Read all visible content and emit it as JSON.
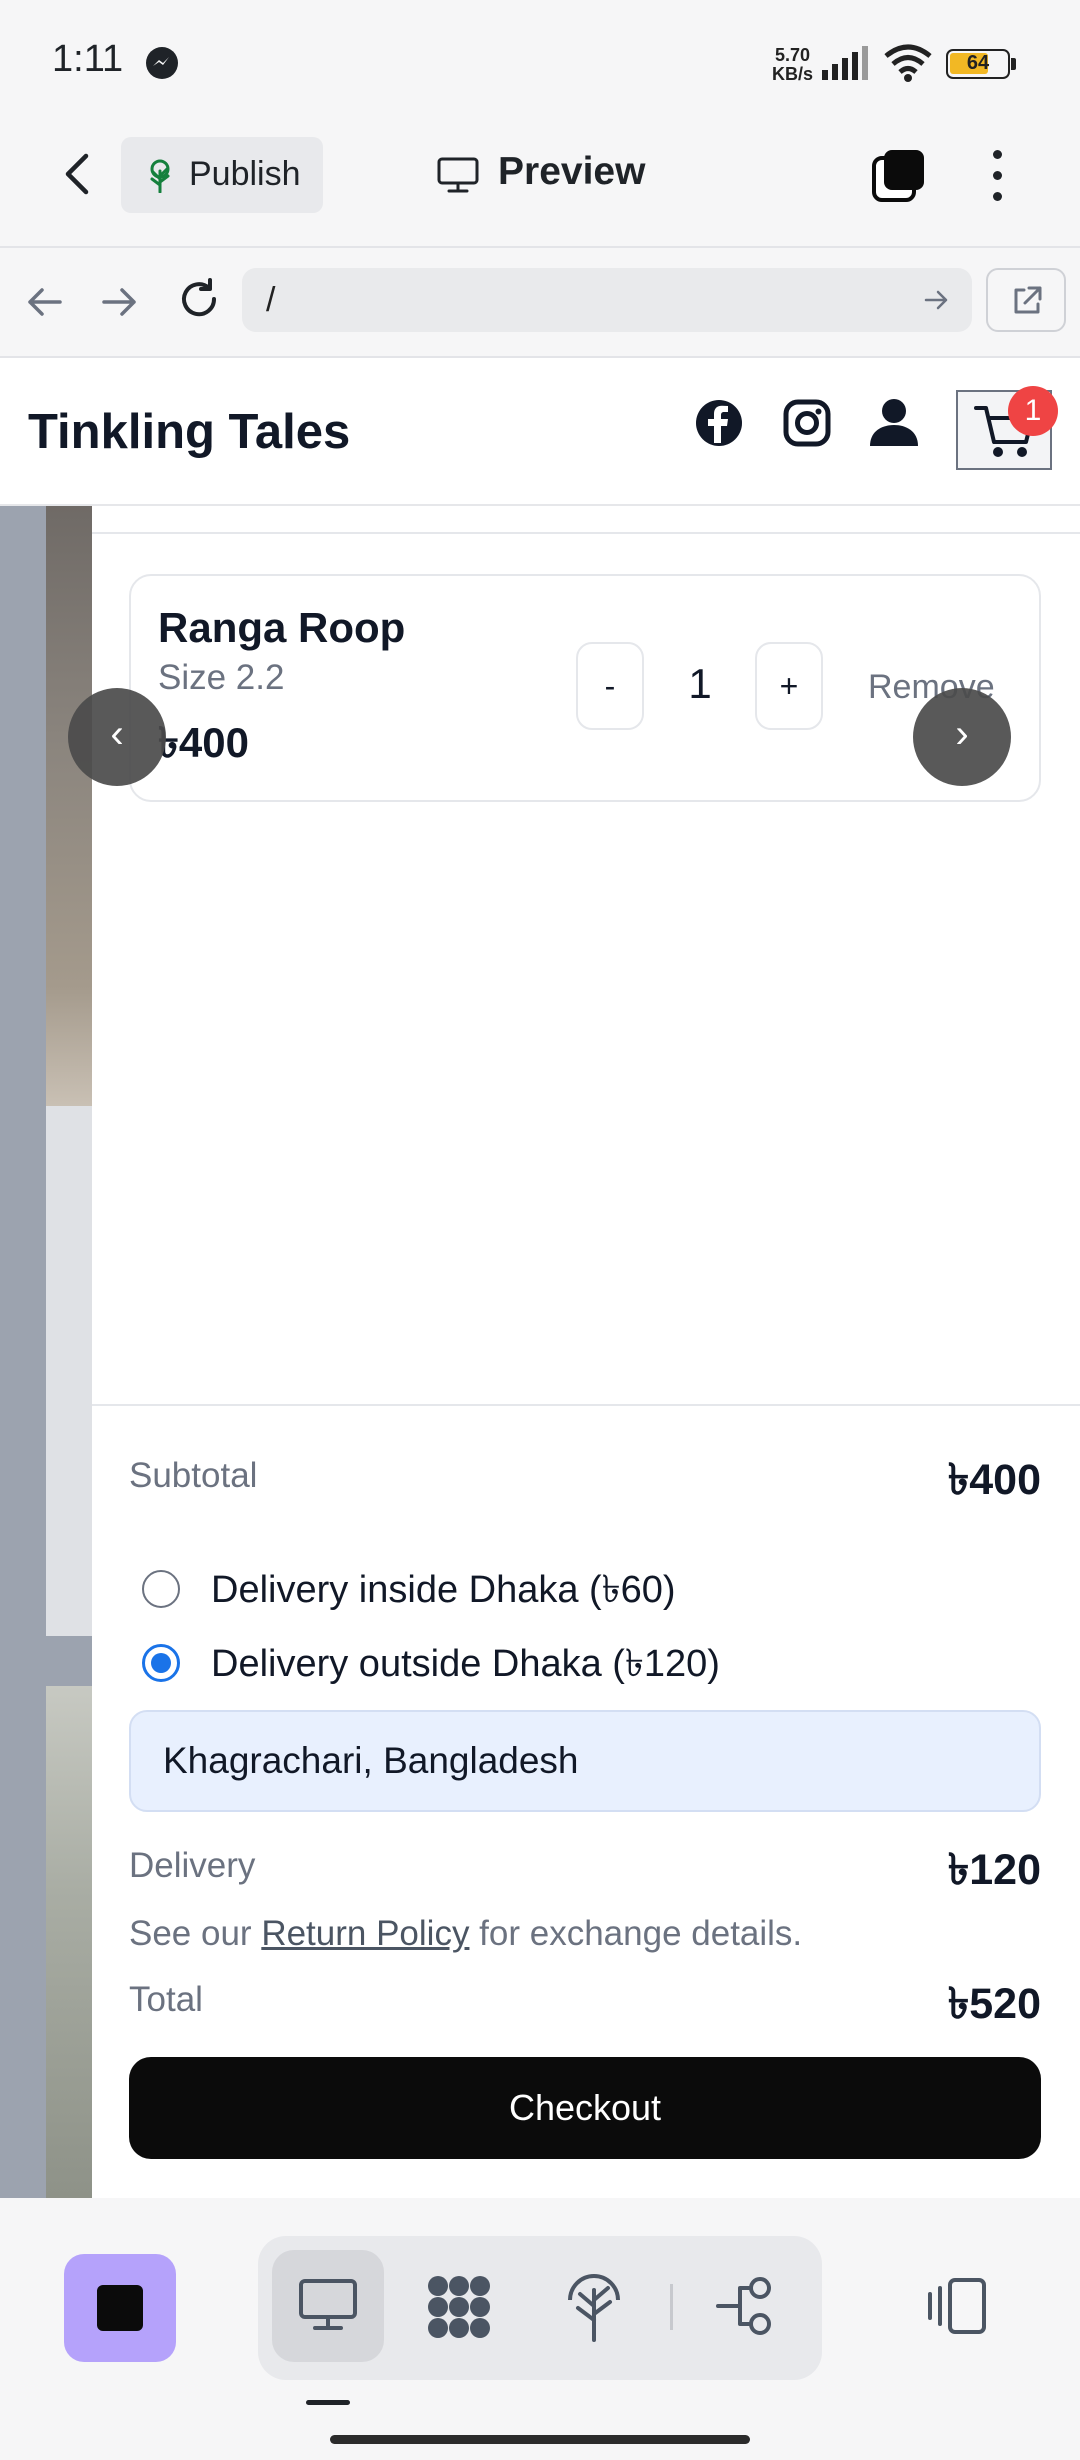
{
  "status_bar": {
    "time": "1:11",
    "net_speed_value": "5.70",
    "net_speed_unit": "KB/s",
    "battery": "64"
  },
  "app_bar": {
    "publish_label": "Publish",
    "preview_label": "Preview"
  },
  "browser": {
    "url": "/"
  },
  "site": {
    "brand": "Tinkling Tales",
    "cart_count": "1"
  },
  "cart": {
    "item": {
      "name": "Ranga Roop",
      "size": "Size 2.2",
      "price": "৳400",
      "quantity": "1",
      "minus_label": "-",
      "plus_label": "+",
      "remove_label": "Remove"
    },
    "carousel": {
      "prev": "‹",
      "next": "›"
    },
    "summary": {
      "subtotal_label": "Subtotal",
      "subtotal_value": "৳400",
      "delivery_options": [
        {
          "label": "Delivery inside Dhaka (৳60)",
          "selected": false
        },
        {
          "label": "Delivery outside Dhaka (৳120)",
          "selected": true
        }
      ],
      "address_value": "Khagrachari, Bangladesh",
      "delivery_label": "Delivery",
      "delivery_value": "৳120",
      "policy_prefix": "See our ",
      "policy_link": "Return Policy",
      "policy_suffix": " for exchange details.",
      "total_label": "Total",
      "total_value": "৳520",
      "checkout_label": "Checkout"
    }
  },
  "colors": {
    "accent_blue": "#1a73e8",
    "badge_red": "#ef4444",
    "checkout_black": "#0b0b0b",
    "app_square_purple": "#b5a2fb"
  }
}
